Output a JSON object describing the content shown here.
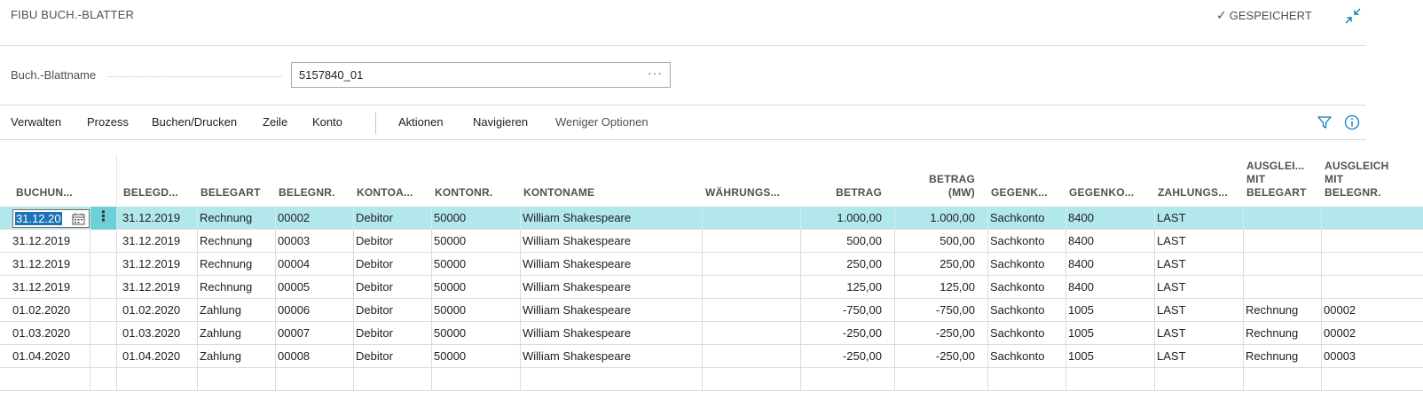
{
  "header": {
    "title": "FIBU BUCH.-BLATTER",
    "saved_label": "GESPEICHERT",
    "saved_icon": "check-icon",
    "collapse_icon": "collapse-icon"
  },
  "journal_field": {
    "label": "Buch.-Blattname",
    "value": "5157840_01",
    "ellipsis": "···"
  },
  "actions": {
    "items": [
      "Verwalten",
      "Prozess",
      "Buchen/Drucken",
      "Zeile",
      "Konto"
    ],
    "secondary": [
      "Aktionen",
      "Navigieren"
    ],
    "fewer_options": "Weniger Optionen",
    "filter_icon": "filter-icon",
    "info_icon": "info-icon"
  },
  "grid": {
    "columns": [
      "BUCHUN...",
      "BELEGD...",
      "BELEGART",
      "BELEGNR.",
      "KONTOA...",
      "KONTONR.",
      "KONTONAME",
      "WÄHRUNGS...",
      "BETRAG",
      "BETRAG (MW)",
      "GEGENK...",
      "GEGENKO...",
      "ZAHLUNGS...",
      "AUSGLEI... MIT BELEGART",
      "AUSGLEICH MIT BELEGNR."
    ],
    "editing_value": "31.12.20",
    "menu_glyph": "⋮",
    "rows": [
      [
        "31.12.2019",
        "31.12.2019",
        "Rechnung",
        "00002",
        "Debitor",
        "50000",
        "William Shakespeare",
        "",
        "1.000,00",
        "1.000,00",
        "Sachkonto",
        "8400",
        "LAST",
        "",
        ""
      ],
      [
        "31.12.2019",
        "31.12.2019",
        "Rechnung",
        "00003",
        "Debitor",
        "50000",
        "William Shakespeare",
        "",
        "500,00",
        "500,00",
        "Sachkonto",
        "8400",
        "LAST",
        "",
        ""
      ],
      [
        "31.12.2019",
        "31.12.2019",
        "Rechnung",
        "00004",
        "Debitor",
        "50000",
        "William Shakespeare",
        "",
        "250,00",
        "250,00",
        "Sachkonto",
        "8400",
        "LAST",
        "",
        ""
      ],
      [
        "31.12.2019",
        "31.12.2019",
        "Rechnung",
        "00005",
        "Debitor",
        "50000",
        "William Shakespeare",
        "",
        "125,00",
        "125,00",
        "Sachkonto",
        "8400",
        "LAST",
        "",
        ""
      ],
      [
        "01.02.2020",
        "01.02.2020",
        "Zahlung",
        "00006",
        "Debitor",
        "50000",
        "William Shakespeare",
        "",
        "-750,00",
        "-750,00",
        "Sachkonto",
        "1005",
        "LAST",
        "Rechnung",
        "00002"
      ],
      [
        "01.03.2020",
        "01.03.2020",
        "Zahlung",
        "00007",
        "Debitor",
        "50000",
        "William Shakespeare",
        "",
        "-250,00",
        "-250,00",
        "Sachkonto",
        "1005",
        "LAST",
        "Rechnung",
        "00002"
      ],
      [
        "01.04.2020",
        "01.04.2020",
        "Zahlung",
        "00008",
        "Debitor",
        "50000",
        "William Shakespeare",
        "",
        "-250,00",
        "-250,00",
        "Sachkonto",
        "1005",
        "LAST",
        "Rechnung",
        "00003"
      ],
      [
        "",
        "",
        "",
        "",
        "",
        "",
        "",
        "",
        "",
        "",
        "",
        "",
        "",
        "",
        ""
      ]
    ]
  },
  "colors": {
    "selected_row": "#b2e7ec",
    "menu_cell": "#6ecfd9",
    "accent": "#0f7bb8"
  }
}
